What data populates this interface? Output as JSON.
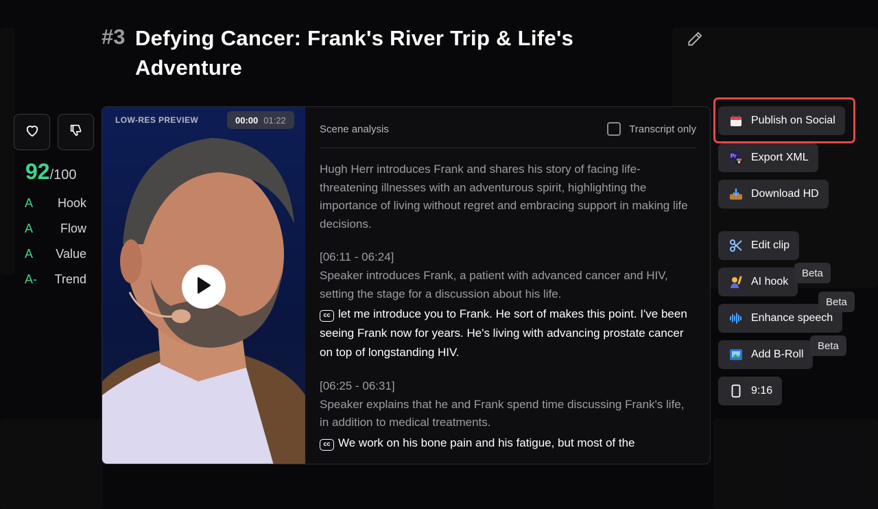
{
  "header": {
    "clip_number": "#3",
    "title": "Defying Cancer: Frank's River Trip & Life's Adventure"
  },
  "score": {
    "value": "92",
    "max": "/100",
    "grades": [
      {
        "grade": "A",
        "label": "Hook"
      },
      {
        "grade": "A",
        "label": "Flow"
      },
      {
        "grade": "A",
        "label": "Value"
      },
      {
        "grade": "A-",
        "label": "Trend"
      }
    ]
  },
  "video": {
    "preview_label": "LOW-RES PREVIEW",
    "current_time": "00:00",
    "duration": "01:22"
  },
  "panel": {
    "heading": "Scene analysis",
    "transcript_only_label": "Transcript only",
    "transcript_only_checked": false,
    "summary": "Hugh Herr introduces Frank and shares his story of facing life-threatening illnesses with an adventurous spirit, highlighting the importance of living without regret and embracing support in making life decisions.",
    "segments": [
      {
        "time": "[06:11 - 06:24]",
        "description": "Speaker introduces Frank, a patient with advanced cancer and HIV, setting the stage for a discussion about his life.",
        "quote": "let me introduce you to Frank. He sort of makes this point. I've been seeing Frank now for years. He's living with advancing prostate cancer on top of longstanding HIV."
      },
      {
        "time": "[06:25 - 06:31]",
        "description": "Speaker explains that he and Frank spend time discussing Frank's life, in addition to medical treatments.",
        "quote": "We work on his bone pain and his fatigue, but most of the"
      }
    ]
  },
  "actions": {
    "publish": "Publish on Social",
    "export_xml": "Export XML",
    "download_hd": "Download HD",
    "edit_clip": "Edit clip",
    "ai_hook": "AI hook",
    "enhance_speech": "Enhance speech",
    "add_broll": "Add B-Roll",
    "aspect_ratio": "9:16",
    "beta_label": "Beta"
  },
  "colors": {
    "accent_green": "#3fd58f",
    "highlight_red": "#e5484d"
  }
}
